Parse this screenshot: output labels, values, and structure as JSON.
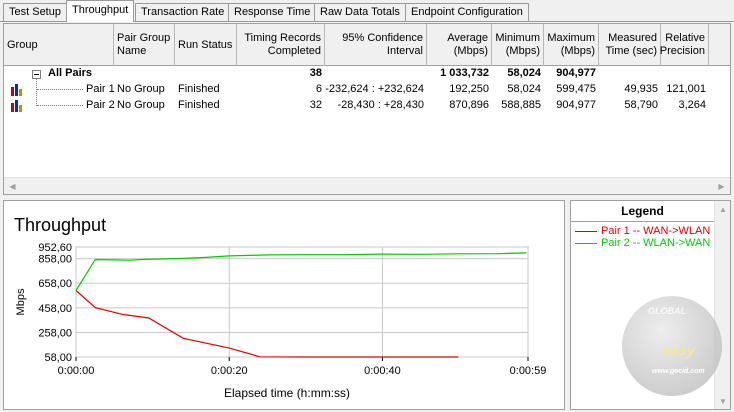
{
  "tabs": [
    {
      "label": "Test Setup",
      "active": false
    },
    {
      "label": "Throughput",
      "active": true
    },
    {
      "label": "Transaction Rate",
      "active": false
    },
    {
      "label": "Response Time",
      "active": false
    },
    {
      "label": "Raw Data Totals",
      "active": false
    },
    {
      "label": "Endpoint Configuration",
      "active": false
    }
  ],
  "grid": {
    "columns": [
      {
        "label": "Group"
      },
      {
        "label": "Pair Group\nName"
      },
      {
        "label": "Run Status"
      },
      {
        "label": "Timing Records\nCompleted"
      },
      {
        "label": "95% Confidence\nInterval"
      },
      {
        "label": "Average\n(Mbps)"
      },
      {
        "label": "Minimum\n(Mbps)"
      },
      {
        "label": "Maximum\n(Mbps)"
      },
      {
        "label": "Measured\nTime (sec)"
      },
      {
        "label": "Relative\nPrecision"
      }
    ],
    "summary": {
      "group": "All Pairs",
      "timing_records": "38",
      "average": "1 033,732",
      "minimum": "58,024",
      "maximum": "904,977"
    },
    "rows": [
      {
        "group": "Pair 1",
        "pair_group_name": "No Group",
        "run_status": "Finished",
        "timing_records": "6",
        "confidence": "-232,624 : +232,624",
        "average": "192,250",
        "minimum": "58,024",
        "maximum": "599,475",
        "measured_time": "49,935",
        "relative_precision": "121,001"
      },
      {
        "group": "Pair 2",
        "pair_group_name": "No Group",
        "run_status": "Finished",
        "timing_records": "32",
        "confidence": "-28,430 : +28,430",
        "average": "870,896",
        "minimum": "588,885",
        "maximum": "904,977",
        "measured_time": "58,790",
        "relative_precision": "3,264"
      }
    ]
  },
  "chart_data": {
    "type": "line",
    "title": "Throughput",
    "xlabel": "Elapsed time (h:mm:ss)",
    "ylabel": "Mbps",
    "yticks": [
      "58,00",
      "258,00",
      "458,00",
      "658,00",
      "858,00",
      "952,60"
    ],
    "ytick_values": [
      58,
      258,
      458,
      658,
      858,
      952.6
    ],
    "ylim": [
      58,
      952.6
    ],
    "xticks": [
      "0:00:00",
      "0:00:20",
      "0:00:40",
      "0:00:59"
    ],
    "xtick_values": [
      0,
      20,
      40,
      59
    ],
    "xlim": [
      0,
      59
    ],
    "grid": true,
    "series": [
      {
        "name": "Pair 1 -- WAN->WLAN",
        "color": "#e00000",
        "x": [
          0,
          2.5,
          6,
          9.5,
          14,
          20,
          24,
          30,
          40,
          49.9
        ],
        "y": [
          599,
          460,
          405,
          375,
          210,
          130,
          60,
          58,
          58,
          58
        ]
      },
      {
        "name": "Pair 2 -- WLAN->WAN",
        "color": "#00cc00",
        "x": [
          0,
          2.5,
          5,
          7,
          9,
          11,
          14,
          17,
          20,
          25,
          30,
          35,
          40,
          45,
          50,
          55,
          58.8
        ],
        "y": [
          599,
          850,
          848,
          845,
          852,
          855,
          860,
          868,
          880,
          888,
          890,
          890,
          895,
          893,
          897,
          898,
          905
        ]
      }
    ]
  },
  "legend": {
    "title": "Legend"
  },
  "watermark": {
    "text_top": "GLOBAL",
    "text_brand": "easy",
    "text_url": "www.gecid.com"
  }
}
